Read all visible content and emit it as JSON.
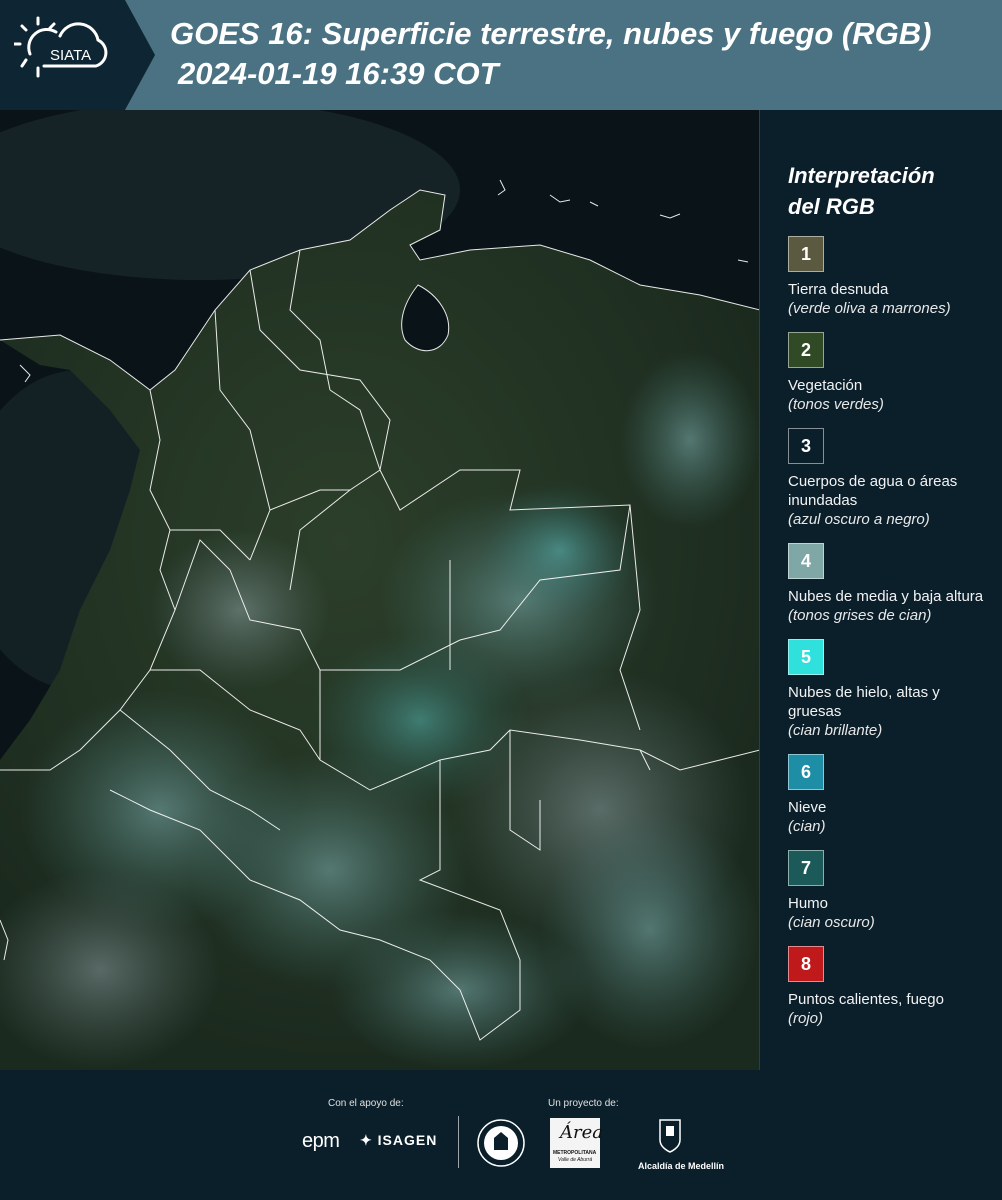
{
  "header": {
    "logo_text": "SIATA",
    "title_line1": "GOES 16: Superficie terrestre, nubes y fuego (RGB)",
    "title_line2": "2024-01-19 16:39 COT",
    "background_color": "#4a7282",
    "logo_background_color": "#0e2633"
  },
  "map": {
    "image_type": "satellite-rgb-composite",
    "region": "Colombia",
    "boundary_line_color": "#ffffff"
  },
  "legend": {
    "title_line1": "Interpretación",
    "title_line2": "del RGB",
    "items": [
      {
        "number": "1",
        "label": "Tierra desnuda",
        "sub": "(verde oliva a marrones)",
        "color": "#5b5a40"
      },
      {
        "number": "2",
        "label": "Vegetación",
        "sub": "(tonos verdes)",
        "color": "#2f4a24"
      },
      {
        "number": "3",
        "label": "Cuerpos de agua o áreas inundadas",
        "sub": "(azul oscuro a negro)",
        "color": "#0b1f2b"
      },
      {
        "number": "4",
        "label": "Nubes de media y baja altura",
        "sub": "(tonos grises de cian)",
        "color": "#7ea7a5"
      },
      {
        "number": "5",
        "label": "Nubes de hielo, altas y gruesas",
        "sub": "(cian brillante)",
        "color": "#2fe0dd"
      },
      {
        "number": "6",
        "label": "Nieve",
        "sub": "(cian)",
        "color": "#1d8ea6"
      },
      {
        "number": "7",
        "label": "Humo",
        "sub": "(cian oscuro)",
        "color": "#1c5a5a"
      },
      {
        "number": "8",
        "label": "Puntos calientes, fuego",
        "sub": "(rojo)",
        "color": "#c0191c"
      }
    ]
  },
  "footer": {
    "support_label": "Con el apoyo de:",
    "project_label": "Un proyecto de:",
    "epm_text": "epm",
    "isagen_text": "ISAGEN",
    "area_text": "Área",
    "area_sub1": "METROPOLITANA",
    "area_sub2": "Valle de Aburrá",
    "medellin_text": "Alcaldía de Medellín"
  }
}
